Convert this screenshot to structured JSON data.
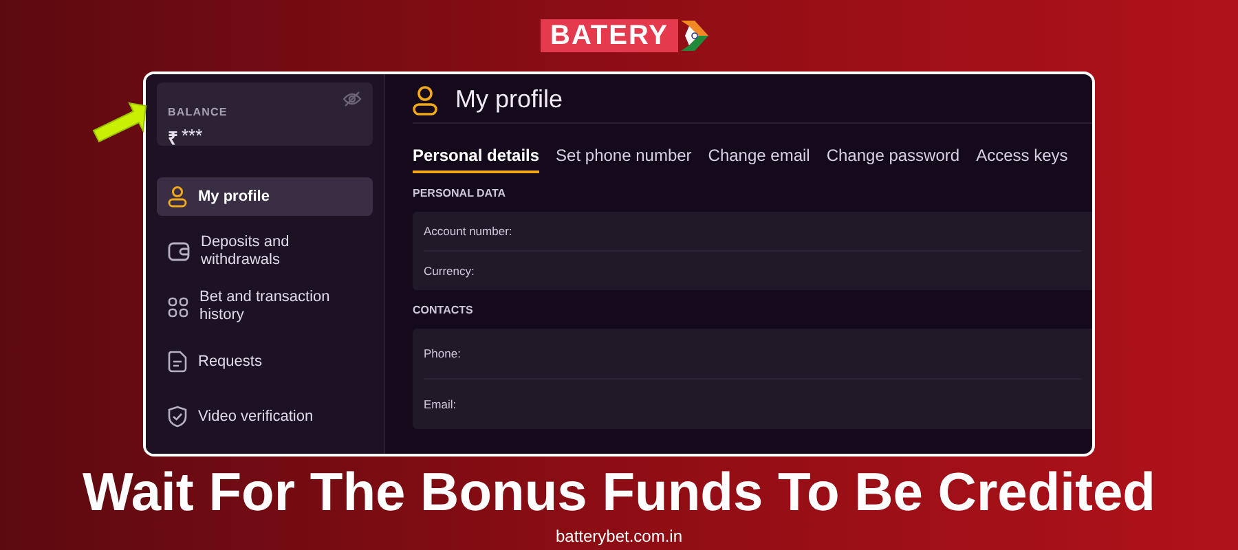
{
  "logo": {
    "text": "BATERY"
  },
  "balance": {
    "label": "BALANCE",
    "currency": "₹",
    "amount": "***",
    "hidden": true
  },
  "sidebar": {
    "items": [
      {
        "label": "My profile",
        "selected": true
      },
      {
        "label": "Deposits and withdrawals",
        "selected": false
      },
      {
        "label": "Bet and transaction history",
        "selected": false
      },
      {
        "label": "Requests",
        "selected": false
      },
      {
        "label": "Video verification",
        "selected": false
      }
    ]
  },
  "page": {
    "title": "My profile",
    "tabs": [
      {
        "label": "Personal details",
        "selected": true
      },
      {
        "label": "Set phone number",
        "selected": false
      },
      {
        "label": "Change email",
        "selected": false
      },
      {
        "label": "Change password",
        "selected": false
      },
      {
        "label": "Access keys",
        "selected": false
      }
    ],
    "sections": [
      {
        "heading": "PERSONAL DATA",
        "fields": [
          "Account number:",
          "Currency:"
        ]
      },
      {
        "heading": "CONTACTS",
        "fields": [
          "Phone:",
          "Email:"
        ]
      }
    ]
  },
  "headline": "Wait For The Bonus Funds To Be Credited",
  "site": "batterybet.com.in"
}
